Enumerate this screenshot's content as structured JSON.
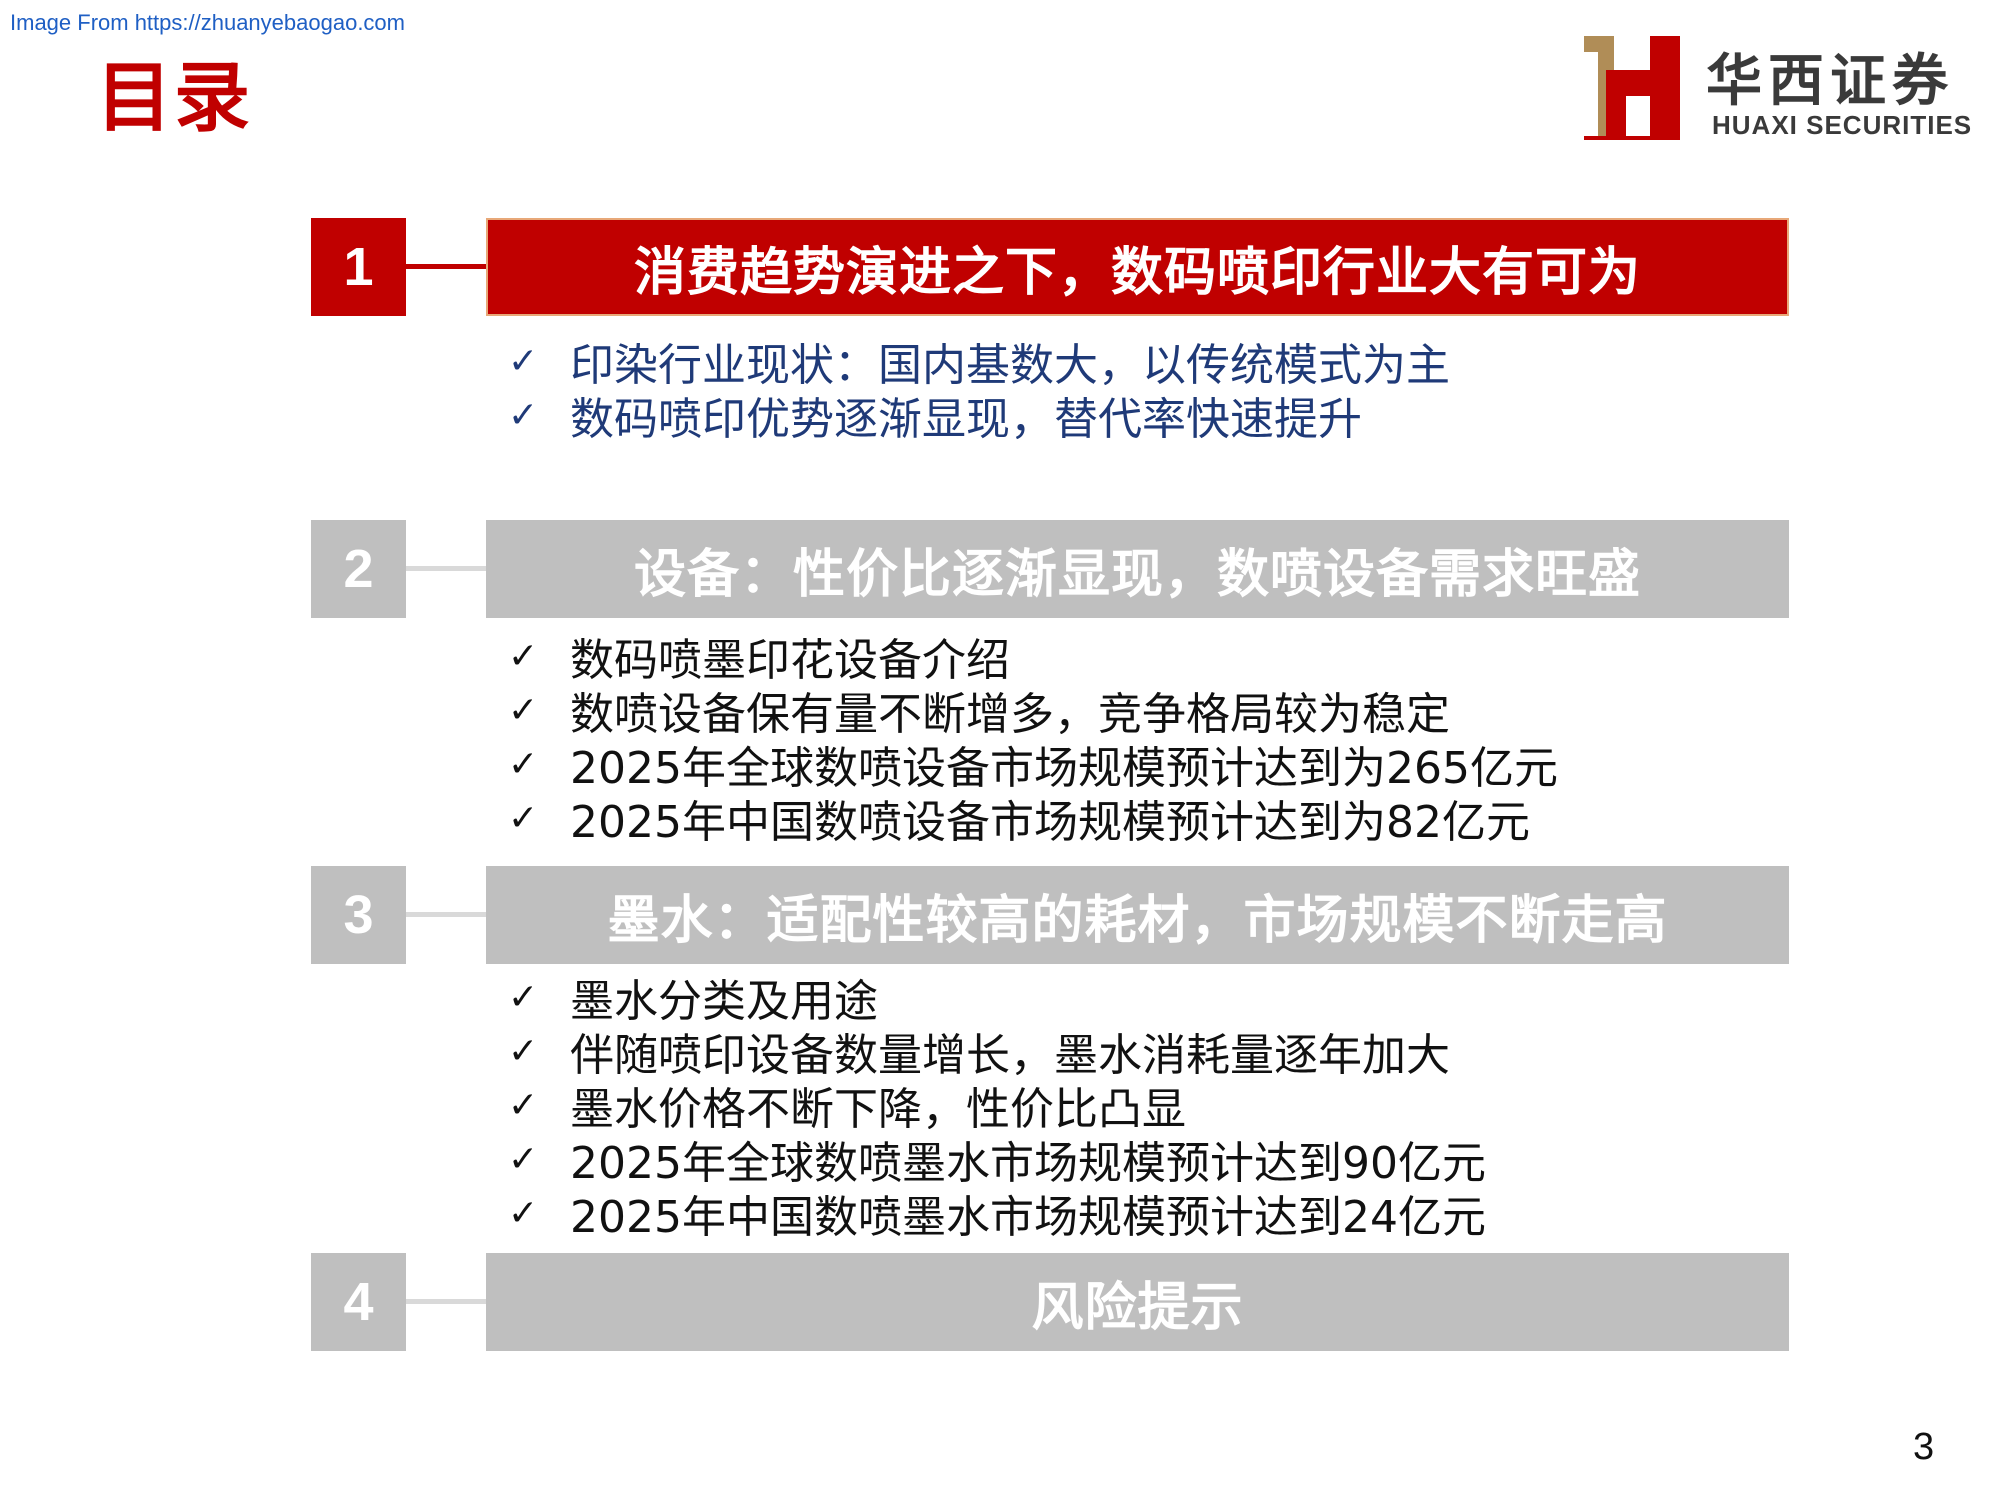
{
  "watermark": "Image From https://zhuanyebaogao.com",
  "page_title": "目录",
  "logo": {
    "cn": "华西证券",
    "en": "HUAXI SECURITIES",
    "colors": {
      "gold": "#b08d57",
      "red": "#c00000"
    }
  },
  "sections": [
    {
      "number": "1",
      "title": "消费趋势演进之下，数码喷印行业大有可为",
      "active": true,
      "items": [
        "印染行业现状：国内基数大，以传统模式为主",
        "数码喷印优势逐渐显现，替代率快速提升"
      ]
    },
    {
      "number": "2",
      "title": "设备：性价比逐渐显现，数喷设备需求旺盛",
      "active": false,
      "items": [
        "数码喷墨印花设备介绍",
        "数喷设备保有量不断增多，竞争格局较为稳定",
        "2025年全球数喷设备市场规模预计达到为265亿元",
        "2025年中国数喷设备市场规模预计达到为82亿元"
      ]
    },
    {
      "number": "3",
      "title": "墨水：适配性较高的耗材，市场规模不断走高",
      "active": false,
      "items": [
        "墨水分类及用途",
        "伴随喷印设备数量增长，墨水消耗量逐年加大",
        "墨水价格不断下降，性价比凸显",
        "2025年全球数喷墨水市场规模预计达到90亿元",
        "2025年中国数喷墨水市场规模预计达到24亿元"
      ]
    },
    {
      "number": "4",
      "title": "风险提示",
      "active": false,
      "items": []
    }
  ],
  "check_glyph": "✓",
  "page_number": "3",
  "colors": {
    "accent": "#c00000",
    "inactive": "#bfbfbf",
    "active_text": "#1f3a78"
  }
}
